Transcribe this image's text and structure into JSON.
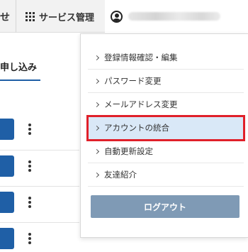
{
  "header": {
    "partial_nav_label": "せ",
    "service_label": "サービス管理"
  },
  "left": {
    "tab_label": "申し込み"
  },
  "dropdown": {
    "items": [
      {
        "label": "登録情報確認・編集"
      },
      {
        "label": "パスワード変更"
      },
      {
        "label": "メールアドレス変更"
      },
      {
        "label": "アカウントの統合",
        "highlighted": true
      },
      {
        "label": "自動更新設定"
      },
      {
        "label": "友達紹介"
      }
    ],
    "logout_label": "ログアウト"
  },
  "colors": {
    "accent_blue": "#1f5fa6",
    "highlight_bg": "#d9e8f7",
    "highlight_border": "#e0202a",
    "logout_bg": "#7f9ab5"
  }
}
